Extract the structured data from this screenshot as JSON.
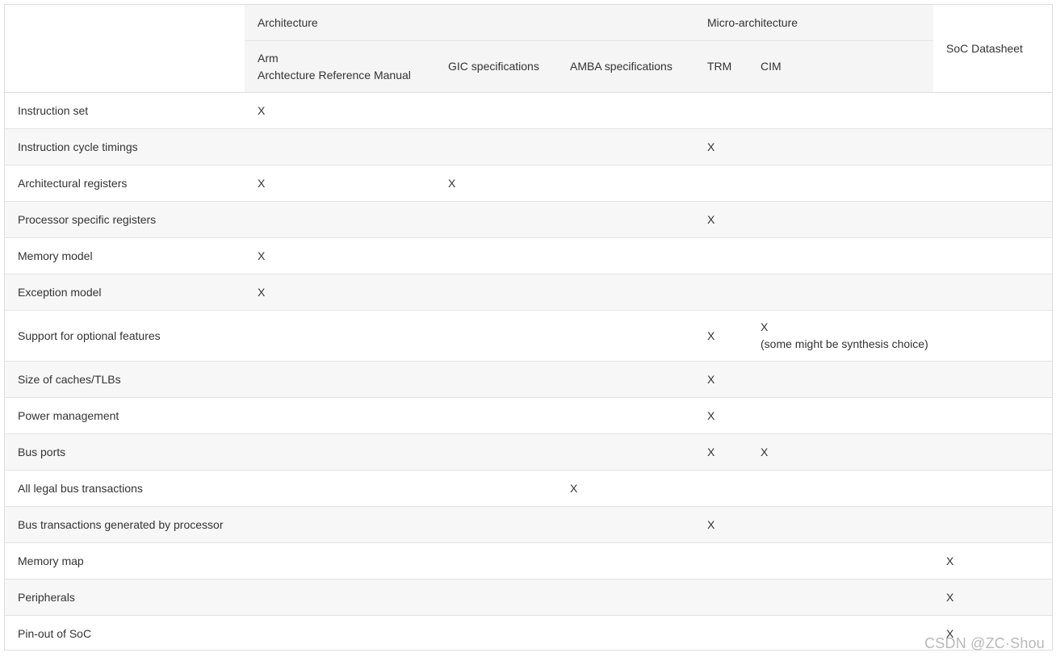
{
  "table": {
    "groups": {
      "architecture": "Architecture",
      "micro_architecture": "Micro-architecture",
      "soc": "SoC Datasheet"
    },
    "columns": {
      "arm_line1": "Arm",
      "arm_line2": "Archtecture Reference Manual",
      "gic": "GIC specifications",
      "amba": "AMBA specifications",
      "trm": "TRM",
      "cim": "CIM"
    },
    "rows": [
      {
        "label": "Instruction set",
        "arm": "X",
        "gic": "",
        "amba": "",
        "trm": "",
        "cim": "",
        "cim_note": "",
        "soc": ""
      },
      {
        "label": "Instruction cycle timings",
        "arm": "",
        "gic": "",
        "amba": "",
        "trm": "X",
        "cim": "",
        "cim_note": "",
        "soc": ""
      },
      {
        "label": "Architectural registers",
        "arm": "X",
        "gic": "X",
        "amba": "",
        "trm": "",
        "cim": "",
        "cim_note": "",
        "soc": ""
      },
      {
        "label": "Processor specific registers",
        "arm": "",
        "gic": "",
        "amba": "",
        "trm": "X",
        "cim": "",
        "cim_note": "",
        "soc": ""
      },
      {
        "label": "Memory model",
        "arm": "X",
        "gic": "",
        "amba": "",
        "trm": "",
        "cim": "",
        "cim_note": "",
        "soc": ""
      },
      {
        "label": "Exception model",
        "arm": "X",
        "gic": "",
        "amba": "",
        "trm": "",
        "cim": "",
        "cim_note": "",
        "soc": ""
      },
      {
        "label": "Support for optional features",
        "arm": "",
        "gic": "",
        "amba": "",
        "trm": "X",
        "cim": "X",
        "cim_note": "(some might be synthesis choice)",
        "soc": ""
      },
      {
        "label": "Size of caches/TLBs",
        "arm": "",
        "gic": "",
        "amba": "",
        "trm": "X",
        "cim": "",
        "cim_note": "",
        "soc": ""
      },
      {
        "label": "Power management",
        "arm": "",
        "gic": "",
        "amba": "",
        "trm": "X",
        "cim": "",
        "cim_note": "",
        "soc": ""
      },
      {
        "label": "Bus ports",
        "arm": "",
        "gic": "",
        "amba": "",
        "trm": "X",
        "cim": "X",
        "cim_note": "",
        "soc": ""
      },
      {
        "label": "All legal bus transactions",
        "arm": "",
        "gic": "",
        "amba": "X",
        "trm": "",
        "cim": "",
        "cim_note": "",
        "soc": ""
      },
      {
        "label": "Bus transactions generated by processor",
        "arm": "",
        "gic": "",
        "amba": "",
        "trm": "X",
        "cim": "",
        "cim_note": "",
        "soc": ""
      },
      {
        "label": "Memory map",
        "arm": "",
        "gic": "",
        "amba": "",
        "trm": "",
        "cim": "",
        "cim_note": "",
        "soc": "X"
      },
      {
        "label": "Peripherals",
        "arm": "",
        "gic": "",
        "amba": "",
        "trm": "",
        "cim": "",
        "cim_note": "",
        "soc": "X"
      },
      {
        "label": "Pin-out of SoC",
        "arm": "",
        "gic": "",
        "amba": "",
        "trm": "",
        "cim": "",
        "cim_note": "",
        "soc": "X"
      }
    ]
  },
  "watermark": "CSDN @ZC·Shou"
}
